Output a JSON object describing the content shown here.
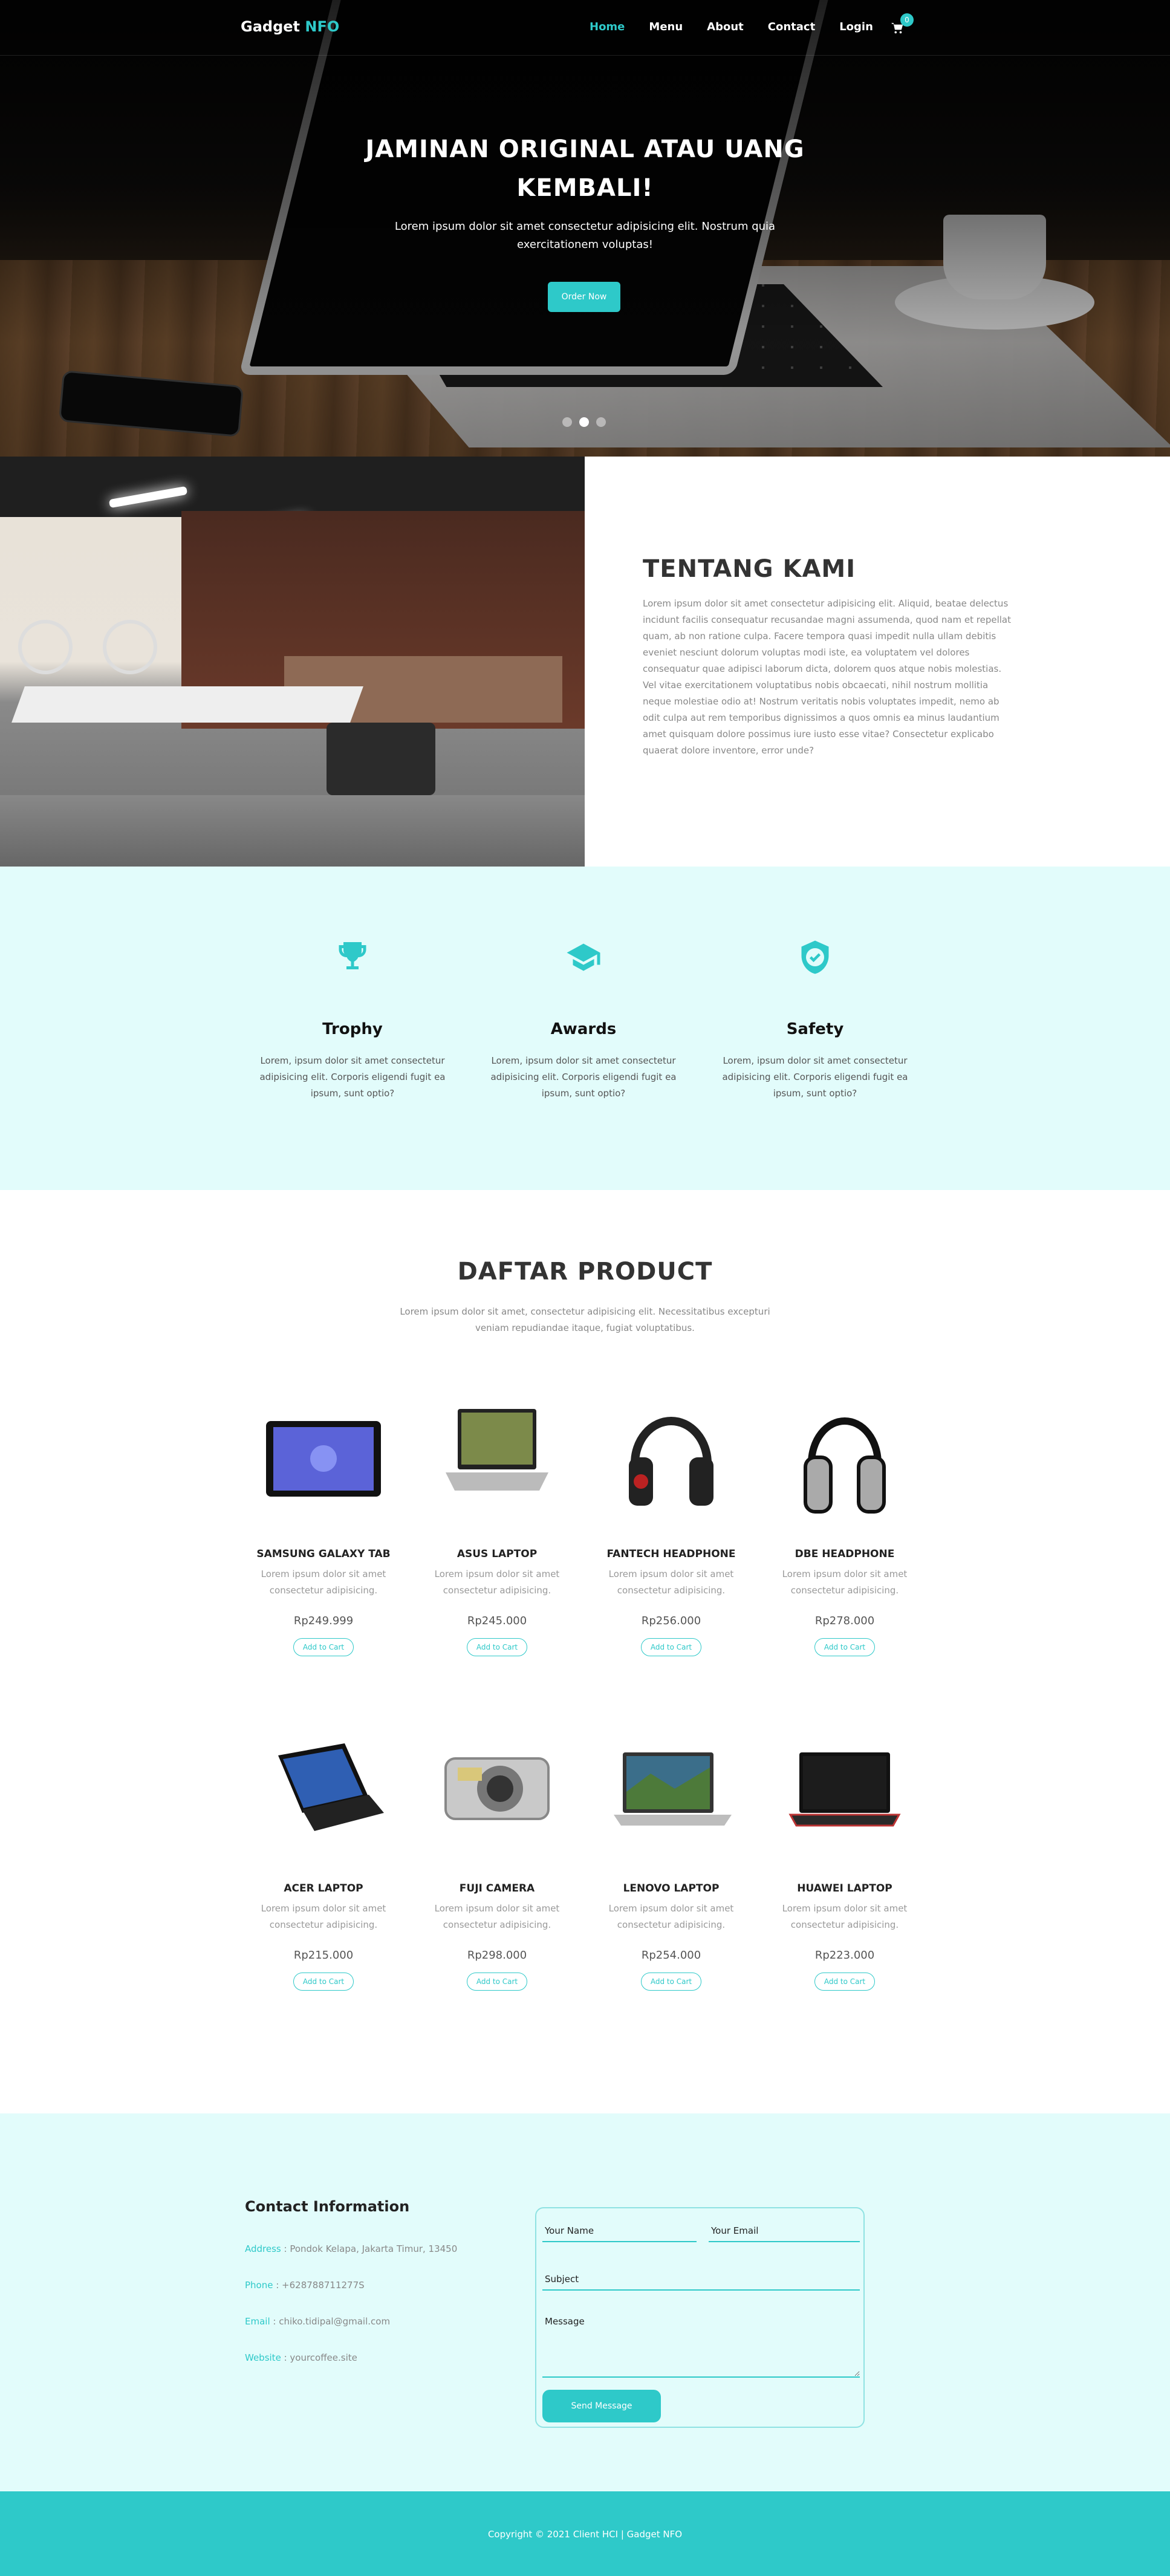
{
  "nav": {
    "brand_main": "Gadget ",
    "brand_accent": "NFO",
    "links": [
      "Home",
      "Menu",
      "About",
      "Contact",
      "Login"
    ],
    "active": "Home",
    "cart_count": "0"
  },
  "hero": {
    "title": "JAMINAN ORIGINAL ATAU UANG KEMBALI!",
    "subtitle": "Lorem ipsum dolor sit amet consectetur adipisicing elit. Nostrum quia exercitationem voluptas!",
    "button": "Order Now",
    "slides": 3,
    "active_slide": 2
  },
  "about": {
    "title": "TENTANG KAMI",
    "text": "Lorem ipsum dolor sit amet consectetur adipisicing elit. Aliquid, beatae delectus incidunt facilis consequatur recusandae magni assumenda, quod nam et repellat quam, ab non ratione culpa. Facere tempora quasi impedit nulla ullam debitis eveniet nesciunt dolorum voluptas modi iste, ea voluptatem vel dolores consequatur quae adipisci laborum dicta, dolorem quos atque nobis molestias. Vel vitae exercitationem voluptatibus nobis obcaecati, nihil nostrum mollitia neque molestiae odio at! Nostrum veritatis nobis voluptates impedit, nemo ab odit culpa aut rem temporibus dignissimos a quos omnis ea minus laudantium amet quisquam dolore possimus iure iusto esse vitae? Consectetur explicabo quaerat dolore inventore, error unde?"
  },
  "features": [
    {
      "title": "Trophy",
      "icon": "trophy-icon",
      "text": "Lorem, ipsum dolor sit amet consectetur adipisicing elit. Corporis eligendi fugit ea ipsum, sunt optio?"
    },
    {
      "title": "Awards",
      "icon": "graduation-cap-icon",
      "text": "Lorem, ipsum dolor sit amet consectetur adipisicing elit. Corporis eligendi fugit ea ipsum, sunt optio?"
    },
    {
      "title": "Safety",
      "icon": "shield-check-icon",
      "text": "Lorem, ipsum dolor sit amet consectetur adipisicing elit. Corporis eligendi fugit ea ipsum, sunt optio?"
    }
  ],
  "products": {
    "title": "DAFTAR PRODUCT",
    "subtitle": "Lorem ipsum dolor sit amet, consectetur adipisicing elit. Necessitatibus excepturi veniam repudiandae itaque, fugiat voluptatibus.",
    "button": "Add to Cart",
    "desc": "Lorem ipsum dolor sit amet consectetur adipisicing.",
    "items": [
      {
        "name": "SAMSUNG GALAXY TAB",
        "price": "Rp249.999",
        "icon": "tablet-icon"
      },
      {
        "name": "ASUS LAPTOP",
        "price": "Rp245.000",
        "icon": "laptop-icon"
      },
      {
        "name": "FANTECH HEADPHONE",
        "price": "Rp256.000",
        "icon": "headphone-icon"
      },
      {
        "name": "DBE HEADPHONE",
        "price": "Rp278.000",
        "icon": "headphone-icon"
      },
      {
        "name": "ACER LAPTOP",
        "price": "Rp215.000",
        "icon": "laptop-icon"
      },
      {
        "name": "FUJI CAMERA",
        "price": "Rp298.000",
        "icon": "camera-icon"
      },
      {
        "name": "LENOVO LAPTOP",
        "price": "Rp254.000",
        "icon": "laptop-icon"
      },
      {
        "name": "HUAWEI LAPTOP",
        "price": "Rp223.000",
        "icon": "laptop-icon"
      }
    ]
  },
  "contact": {
    "title": "Contact Information",
    "address_label": "Address",
    "address": " : Pondok Kelapa, Jakarta Timur, 13450",
    "phone_label": "Phone",
    "phone": " : +628788711277S",
    "email_label": "Email",
    "email": " : chiko.tidipal@gmail.com",
    "website_label": "Website",
    "website": " : yourcoffee.site",
    "form": {
      "name_placeholder": "Your Name",
      "email_placeholder": "Your Email",
      "subject_placeholder": "Subject",
      "message_placeholder": "Message",
      "send": "Send Message"
    }
  },
  "footer": {
    "copyright": "Copyright © 2021 Client HCI | Gadget NFO"
  },
  "colors": {
    "accent": "#2ec9c9",
    "light_bg": "#e2fcfb"
  }
}
